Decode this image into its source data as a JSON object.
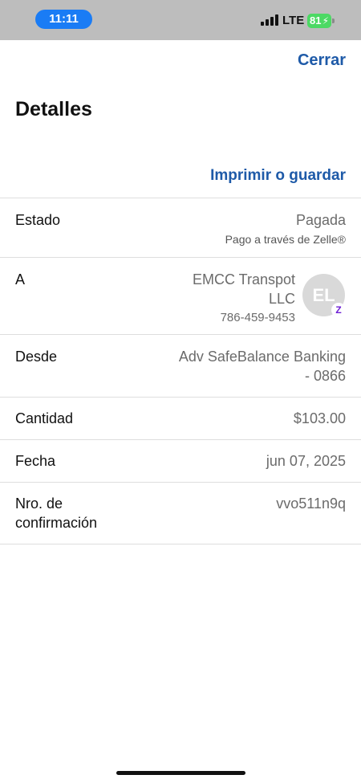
{
  "status_bar": {
    "time": "11:11",
    "network": "LTE",
    "battery": "81",
    "icons": [
      "signal-icon",
      "battery-icon",
      "charging-bolt-icon"
    ]
  },
  "header": {
    "close_label": "Cerrar",
    "title": "Detalles",
    "print_label": "Imprimir o guardar"
  },
  "details": {
    "estado": {
      "label": "Estado",
      "value": "Pagada",
      "sub": "Pago a través de Zelle®"
    },
    "a": {
      "label": "A",
      "name_line1": "EMCC Transpot",
      "name_line2": "LLC",
      "phone": "786-459-9453",
      "avatar_initials": "EL",
      "badge_icon": "zelle-icon"
    },
    "desde": {
      "label": "Desde",
      "value_line1": "Adv SafeBalance Banking",
      "value_line2": "- 0866"
    },
    "cantidad": {
      "label": "Cantidad",
      "value": "$103.00"
    },
    "fecha": {
      "label": "Fecha",
      "value": "jun 07, 2025"
    },
    "confirmacion": {
      "label_line1": "Nro. de",
      "label_line2": "confirmación",
      "value": "vvo511n9q"
    }
  },
  "colors": {
    "link": "#1e5aa8",
    "status_bar": "#bdbdbd",
    "time_pill": "#1a7cf5",
    "battery": "#4cd964",
    "zelle": "#6d1ed4"
  }
}
